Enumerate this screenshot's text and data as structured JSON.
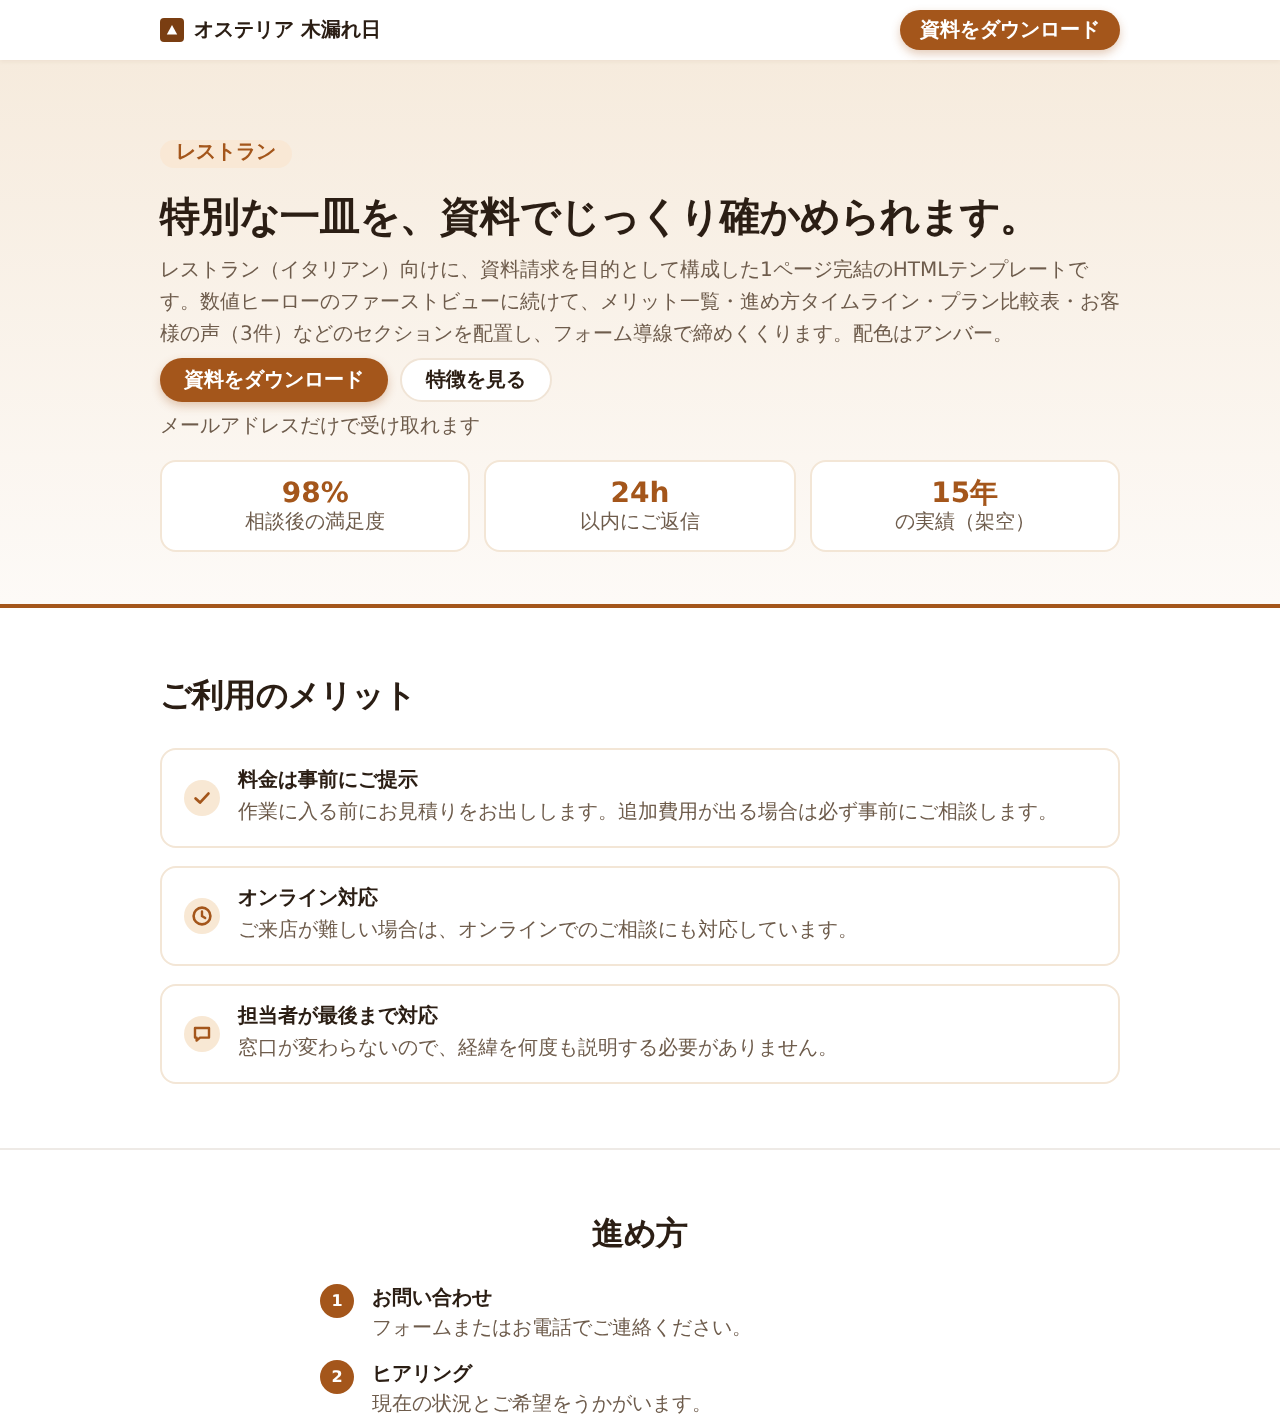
{
  "header": {
    "brand": "オステリア 木漏れ日",
    "cta": "資料をダウンロード"
  },
  "hero": {
    "badge": "レストラン",
    "title": "特別な一皿を、資料でじっくり確かめられます。",
    "lead": "レストラン（イタリアン）向けに、資料請求を目的として構成した1ページ完結のHTMLテンプレートです。数値ヒーローのファーストビューに続けて、メリット一覧・進め方タイムライン・プラン比較表・お客様の声（3件）などのセクションを配置し、フォーム導線で締めくくります。配色はアンバー。",
    "buttons": [
      {
        "label": "資料をダウンロード",
        "kind": "primary"
      },
      {
        "label": "特徴を見る",
        "kind": "secondary"
      }
    ],
    "note": "メールアドレスだけで受け取れます",
    "stats": [
      {
        "value": "98%",
        "label": "相談後の満足度"
      },
      {
        "value": "24h",
        "label": "以内にご返信"
      },
      {
        "value": "15年",
        "label": "の実績（架空）"
      }
    ]
  },
  "merits": {
    "heading": "ご利用のメリット",
    "items": [
      {
        "kind": "check",
        "title": "料金は事前にご提示",
        "text": "作業に入る前にお見積りをお出しします。追加費用が出る場合は必ず事前にご相談します。"
      },
      {
        "kind": "clock",
        "title": "オンライン対応",
        "text": "ご来店が難しい場合は、オンラインでのご相談にも対応しています。"
      },
      {
        "kind": "chat",
        "title": "担当者が最後まで対応",
        "text": "窓口が変わらないので、経緯を何度も説明する必要がありません。"
      }
    ]
  },
  "steps": {
    "heading": "進め方",
    "items": [
      {
        "number": "1",
        "title": "お問い合わせ",
        "text": "フォームまたはお電話でご連絡ください。"
      },
      {
        "number": "2",
        "title": "ヒアリング",
        "text": "現在の状況とご希望をうかがいます。"
      }
    ]
  }
}
